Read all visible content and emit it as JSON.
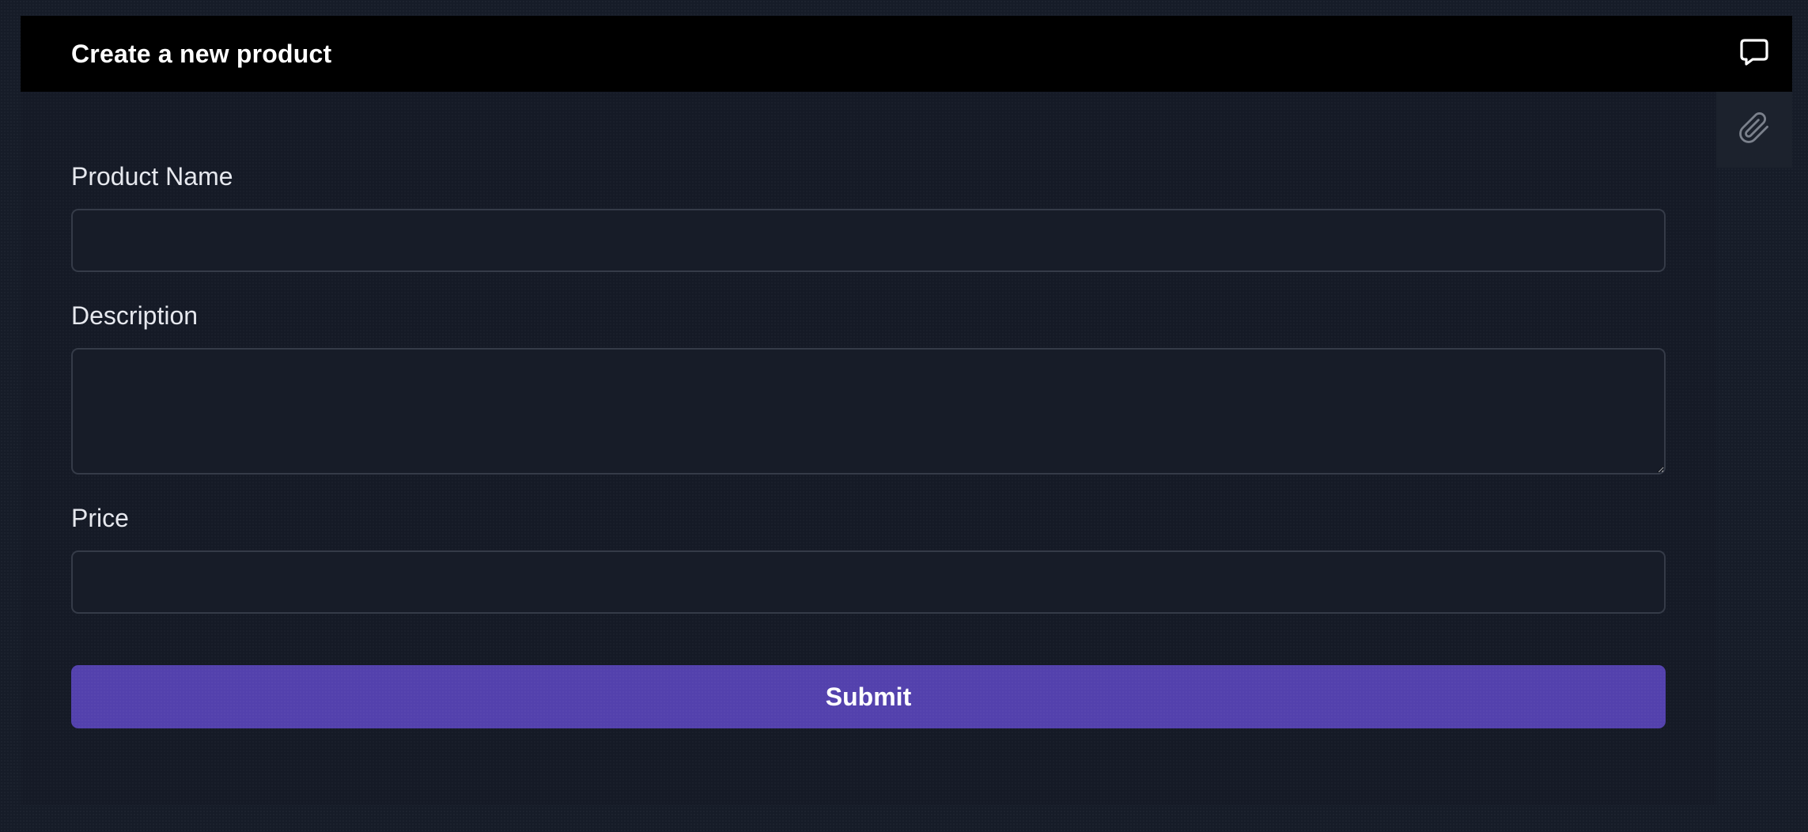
{
  "header": {
    "title": "Create a new product",
    "chat_icon": "chat-bubble-icon"
  },
  "side": {
    "attach_icon": "paperclip-icon"
  },
  "form": {
    "product_name": {
      "label": "Product Name",
      "value": "",
      "placeholder": ""
    },
    "description": {
      "label": "Description",
      "value": "",
      "placeholder": ""
    },
    "price": {
      "label": "Price",
      "value": "",
      "placeholder": ""
    },
    "submit_label": "Submit"
  },
  "colors": {
    "header_bg": "#000000",
    "page_bg": "#161c28",
    "submit_bg": "#5341ad"
  }
}
